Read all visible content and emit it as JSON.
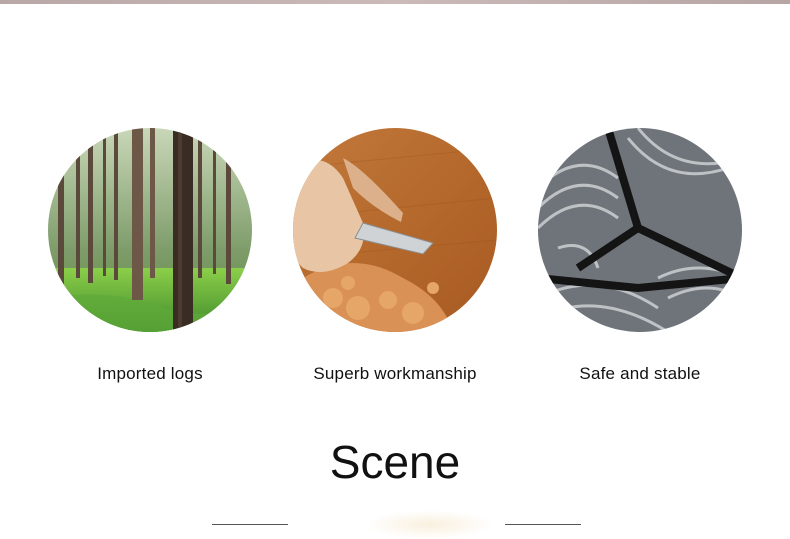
{
  "features": [
    {
      "label": "Imported logs",
      "image": "forest-photo"
    },
    {
      "label": "Superb workmanship",
      "image": "wood-carving-photo"
    },
    {
      "label": "Safe and stable",
      "image": "metal-frame-photo"
    }
  ],
  "section": {
    "title": "Scene"
  }
}
